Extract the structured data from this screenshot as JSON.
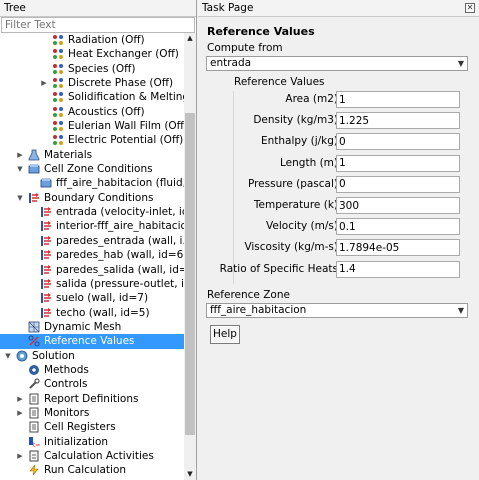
{
  "tree": {
    "title": "Tree",
    "filter_placeholder": "Filter Text",
    "items": [
      {
        "label": "Radiation (Off)",
        "indent": 3,
        "expander": "",
        "icon": "radiation-icon",
        "selected": false
      },
      {
        "label": "Heat Exchanger (Off)",
        "indent": 3,
        "expander": "",
        "icon": "heat-exchanger-icon",
        "selected": false
      },
      {
        "label": "Species (Off)",
        "indent": 3,
        "expander": "",
        "icon": "species-icon",
        "selected": false
      },
      {
        "label": "Discrete Phase (Off)",
        "indent": 3,
        "expander": "▶",
        "icon": "discrete-phase-icon",
        "selected": false
      },
      {
        "label": "Solidification & Melting (...",
        "indent": 3,
        "expander": "",
        "icon": "solidification-icon",
        "selected": false
      },
      {
        "label": "Acoustics (Off)",
        "indent": 3,
        "expander": "",
        "icon": "acoustics-icon",
        "selected": false
      },
      {
        "label": "Eulerian Wall Film (Off)",
        "indent": 3,
        "expander": "",
        "icon": "wall-film-icon",
        "selected": false
      },
      {
        "label": "Electric Potential (Off)",
        "indent": 3,
        "expander": "",
        "icon": "electric-potential-icon",
        "selected": false
      },
      {
        "label": "Materials",
        "indent": 1,
        "expander": "▶",
        "icon": "materials-icon",
        "selected": false
      },
      {
        "label": "Cell Zone Conditions",
        "indent": 1,
        "expander": "▼",
        "icon": "cell-zone-icon",
        "selected": false
      },
      {
        "label": "fff_aire_habitacion (fluid, ...",
        "indent": 2,
        "expander": "",
        "icon": "fluid-zone-icon",
        "selected": false
      },
      {
        "label": "Boundary Conditions",
        "indent": 1,
        "expander": "▼",
        "icon": "boundary-conditions-icon",
        "selected": false
      },
      {
        "label": "entrada (velocity-inlet, id...",
        "indent": 2,
        "expander": "",
        "icon": "boundary-icon",
        "selected": false
      },
      {
        "label": "interior-fff_aire_habitacio...",
        "indent": 2,
        "expander": "",
        "icon": "boundary-icon",
        "selected": false
      },
      {
        "label": "paredes_entrada (wall, i...",
        "indent": 2,
        "expander": "",
        "icon": "boundary-icon",
        "selected": false
      },
      {
        "label": "paredes_hab (wall, id=6)",
        "indent": 2,
        "expander": "",
        "icon": "boundary-icon",
        "selected": false
      },
      {
        "label": "paredes_salida (wall, id=...",
        "indent": 2,
        "expander": "",
        "icon": "boundary-icon",
        "selected": false
      },
      {
        "label": "salida (pressure-outlet, i...",
        "indent": 2,
        "expander": "",
        "icon": "boundary-icon",
        "selected": false
      },
      {
        "label": "suelo (wall, id=7)",
        "indent": 2,
        "expander": "",
        "icon": "boundary-icon",
        "selected": false
      },
      {
        "label": "techo (wall, id=5)",
        "indent": 2,
        "expander": "",
        "icon": "boundary-icon",
        "selected": false
      },
      {
        "label": "Dynamic Mesh",
        "indent": 1,
        "expander": "",
        "icon": "dynamic-mesh-icon",
        "selected": false
      },
      {
        "label": "Reference Values",
        "indent": 1,
        "expander": "",
        "icon": "reference-values-icon",
        "selected": true
      },
      {
        "label": "Solution",
        "indent": 0,
        "expander": "▼",
        "icon": "solution-icon",
        "selected": false
      },
      {
        "label": "Methods",
        "indent": 1,
        "expander": "",
        "icon": "methods-icon",
        "selected": false
      },
      {
        "label": "Controls",
        "indent": 1,
        "expander": "",
        "icon": "controls-icon",
        "selected": false
      },
      {
        "label": "Report Definitions",
        "indent": 1,
        "expander": "▶",
        "icon": "report-definitions-icon",
        "selected": false
      },
      {
        "label": "Monitors",
        "indent": 1,
        "expander": "▶",
        "icon": "monitors-icon",
        "selected": false
      },
      {
        "label": "Cell Registers",
        "indent": 1,
        "expander": "",
        "icon": "cell-registers-icon",
        "selected": false
      },
      {
        "label": "Initialization",
        "indent": 1,
        "expander": "",
        "icon": "initialization-icon",
        "selected": false
      },
      {
        "label": "Calculation Activities",
        "indent": 1,
        "expander": "▶",
        "icon": "calculation-activities-icon",
        "selected": false
      },
      {
        "label": "Run Calculation",
        "indent": 1,
        "expander": "",
        "icon": "run-calculation-icon",
        "selected": false
      }
    ]
  },
  "task": {
    "title": "Task Page",
    "section_title": "Reference Values",
    "compute_from_label": "Compute from",
    "compute_from_value": "entrada",
    "group_label": "Reference Values",
    "properties": [
      {
        "label": "Area (m2)",
        "value": "1"
      },
      {
        "label": "Density (kg/m3)",
        "value": "1.225"
      },
      {
        "label": "Enthalpy (j/kg)",
        "value": "0"
      },
      {
        "label": "Length (m)",
        "value": "1"
      },
      {
        "label": "Pressure (pascal)",
        "value": "0"
      },
      {
        "label": "Temperature (k)",
        "value": "300"
      },
      {
        "label": "Velocity (m/s)",
        "value": "0.1"
      },
      {
        "label": "Viscosity (kg/m-s)",
        "value": "1.7894e-05"
      },
      {
        "label": "Ratio of Specific Heats",
        "value": "1.4"
      }
    ],
    "reference_zone_label": "Reference Zone",
    "reference_zone_value": "fff_aire_habitacion",
    "help_label": "Help"
  },
  "colors": {
    "selection": "#3399ff",
    "panel_bg": "#f0f0f0"
  }
}
